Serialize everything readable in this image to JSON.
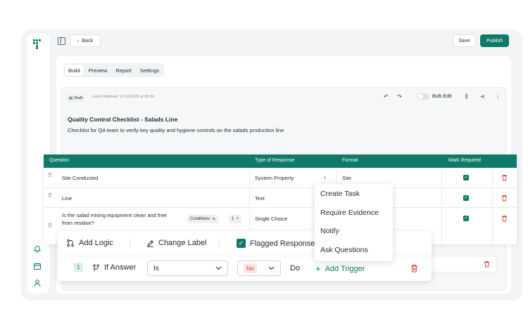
{
  "topbar": {
    "back_label": "Back",
    "save_label": "Save",
    "publish_label": "Publish"
  },
  "tabs": [
    {
      "label": "Build",
      "active": true
    },
    {
      "label": "Preview",
      "active": false
    },
    {
      "label": "Report",
      "active": false
    },
    {
      "label": "Settings",
      "active": false
    }
  ],
  "form": {
    "status": "Draft",
    "last_published": "Last Published: 12.04.2025 at 08:34",
    "bulk_edit_label": "Bulk Edit",
    "title": "Quality Control Checklist - Salads Line",
    "description": "Checklist for QA team to verify key quality and hygiene controls on the salads production line"
  },
  "table": {
    "columns": [
      "Question",
      "Type of Response",
      "Format",
      "Mark Required"
    ],
    "rows": [
      {
        "question": "Site Conducted",
        "type": "System Property",
        "format": "Site",
        "required": true
      },
      {
        "question": "Line",
        "type": "Text",
        "format": "",
        "required": true
      },
      {
        "question": "Is the salad mixing equipment clean and free from residue?",
        "question_line1": "Is the salad mixing equipment clean and free",
        "question_line2": "from residue?",
        "type": "Single Choice",
        "format": "",
        "required": true,
        "conditions_label": "Conditions",
        "branch_count": "1"
      }
    ]
  },
  "dropdown_menu": {
    "items": [
      "Create Task",
      "Require Evidence",
      "Notify",
      "Ask Questions"
    ]
  },
  "logic_panel": {
    "add_logic_label": "Add Logic",
    "change_label_label": "Change Label",
    "flagged_label": "Flagged Responses",
    "rule": {
      "index": "1",
      "if_answer_label": "If Answer",
      "operator": "Is",
      "value": "No",
      "do_label": "Do",
      "add_trigger_label": "Add Trigger"
    }
  },
  "colors": {
    "accent": "#0f7a68",
    "danger": "#d9382e",
    "header_text": "#ffffff"
  }
}
